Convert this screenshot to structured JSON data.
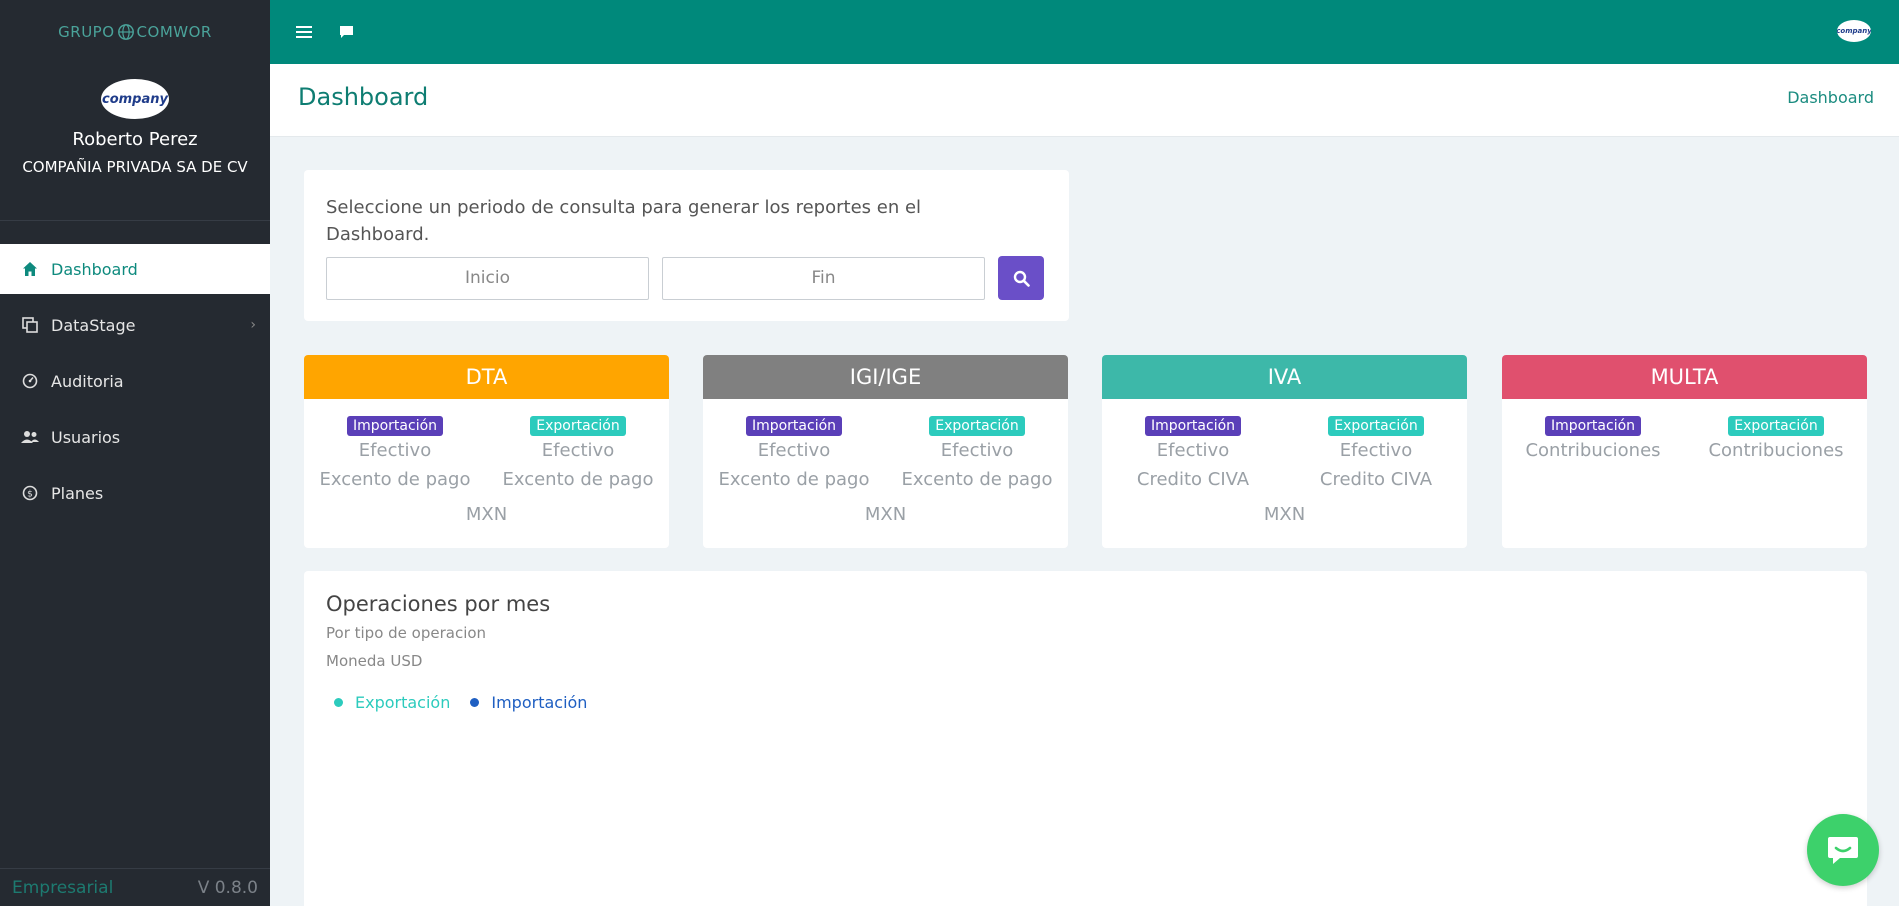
{
  "brand": {
    "left": "GRUPO",
    "right": "COMWOR"
  },
  "profile": {
    "avatar_text": "company",
    "name": "Roberto Perez",
    "company": "COMPAÑIA PRIVADA SA DE CV"
  },
  "nav": {
    "items": [
      {
        "label": "Dashboard",
        "icon": "home-icon"
      },
      {
        "label": "DataStage",
        "icon": "copy-icon"
      },
      {
        "label": "Auditoria",
        "icon": "gauge-icon"
      },
      {
        "label": "Usuarios",
        "icon": "users-icon"
      },
      {
        "label": "Planes",
        "icon": "dollar-icon"
      }
    ]
  },
  "footer": {
    "plan": "Empresarial",
    "version": "V 0.8.0"
  },
  "topbar": {
    "avatar_text": "company"
  },
  "header": {
    "title": "Dashboard",
    "breadcrumb": "Dashboard"
  },
  "period": {
    "text": "Seleccione un periodo de consulta para generar los reportes en el Dashboard.",
    "start_placeholder": "Inicio",
    "end_placeholder": "Fin"
  },
  "cards": [
    {
      "title": "DTA",
      "color": "#ffa500",
      "left": {
        "badge": "Importación",
        "line1": "Efectivo",
        "line2": "Excento de pago"
      },
      "right": {
        "badge": "Exportación",
        "line1": "Efectivo",
        "line2": "Excento de pago"
      },
      "currency": "MXN"
    },
    {
      "title": "IGI/IGE",
      "color": "#808080",
      "left": {
        "badge": "Importación",
        "line1": "Efectivo",
        "line2": "Excento de pago"
      },
      "right": {
        "badge": "Exportación",
        "line1": "Efectivo",
        "line2": "Excento de pago"
      },
      "currency": "MXN"
    },
    {
      "title": "IVA",
      "color": "#3db8a9",
      "left": {
        "badge": "Importación",
        "line1": "Efectivo",
        "line2": "Credito CIVA"
      },
      "right": {
        "badge": "Exportación",
        "line1": "Efectivo",
        "line2": "Credito CIVA"
      },
      "currency": "MXN"
    },
    {
      "title": "MULTA",
      "color": "#e0506e",
      "left": {
        "badge": "Importación",
        "line1": "Contribuciones",
        "line2": ""
      },
      "right": {
        "badge": "Exportación",
        "line1": "Contribuciones",
        "line2": ""
      },
      "currency": ""
    }
  ],
  "operations": {
    "title": "Operaciones por mes",
    "subtitle": "Por tipo de operacion",
    "currency": "Moneda USD",
    "legend": [
      {
        "label": "Exportación",
        "color": "#2ccbbd"
      },
      {
        "label": "Importación",
        "color": "#1f5fc2"
      }
    ]
  },
  "colors": {
    "accent": "#00897b",
    "sidebar": "#252a31",
    "search_button": "#6a4fc8",
    "chat": "#3dd16b"
  }
}
